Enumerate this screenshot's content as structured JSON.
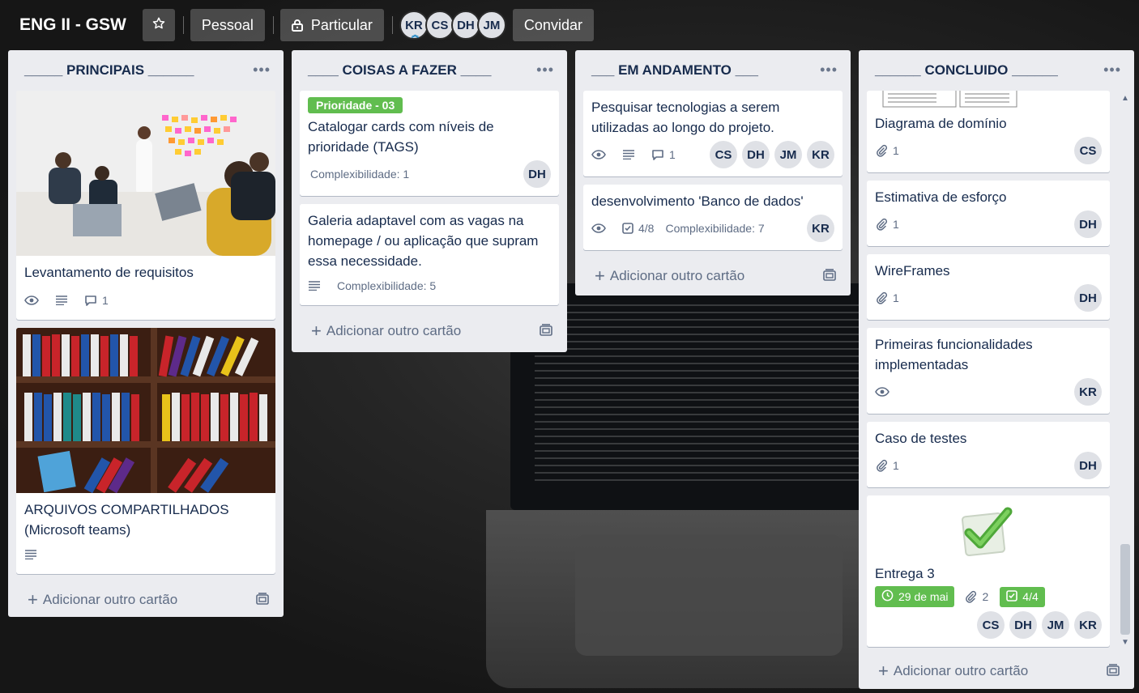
{
  "board": {
    "title": "ENG II - GSW",
    "personal_label": "Pessoal",
    "visibility_label": "Particular",
    "invite_label": "Convidar",
    "members": [
      "KR",
      "CS",
      "DH",
      "JM"
    ]
  },
  "lists": [
    {
      "title": "_____ PRINCIPAIS ______",
      "add_label": "Adicionar outro cartão",
      "cards": [
        {
          "title": "Levantamento de requisitos",
          "comments": "1"
        },
        {
          "title": "ARQUIVOS COMPARTILHADOS (Microsoft teams)"
        }
      ]
    },
    {
      "title": "____ COISAS A FAZER ____",
      "add_label": "Adicionar outro cartão",
      "cards": [
        {
          "label": "Prioridade - 03",
          "title": "Catalogar cards com níveis de prioridade (TAGS)",
          "complexity": "Complexibilidade: 1",
          "members": [
            "DH"
          ]
        },
        {
          "title": "Galeria adaptavel com as vagas na homepage / ou aplicação que supram essa necessidade.",
          "complexity": "Complexibilidade: 5"
        }
      ]
    },
    {
      "title": "___ EM ANDAMENTO ___",
      "add_label": "Adicionar outro cartão",
      "cards": [
        {
          "title": "Pesquisar tecnologias a serem utilizadas ao longo do projeto.",
          "comments": "1",
          "members": [
            "CS",
            "DH",
            "JM",
            "KR"
          ]
        },
        {
          "title": "desenvolvimento 'Banco de dados'",
          "checklist": "4/8",
          "complexity": "Complexibilidade: 7",
          "members": [
            "KR"
          ]
        }
      ]
    },
    {
      "title": "______ CONCLUIDO ______",
      "add_label": "Adicionar outro cartão",
      "cards": [
        {
          "title": "Diagrama de domínio",
          "attachments": "1",
          "members": [
            "CS"
          ]
        },
        {
          "title": "Estimativa de esforço",
          "attachments": "1",
          "members": [
            "DH"
          ]
        },
        {
          "title": "WireFrames",
          "attachments": "1",
          "members": [
            "DH"
          ]
        },
        {
          "title": "Primeiras funcionalidades implementadas",
          "members": [
            "KR"
          ]
        },
        {
          "title": "Caso de testes",
          "attachments": "1",
          "members": [
            "DH"
          ]
        },
        {
          "title": "Entrega 3",
          "due": "29 de mai",
          "attachments": "2",
          "checklist": "4/4",
          "members": [
            "CS",
            "DH",
            "JM",
            "KR"
          ]
        }
      ]
    }
  ],
  "colors": {
    "green": "#61bd4f",
    "list_bg": "#ebecf0"
  }
}
